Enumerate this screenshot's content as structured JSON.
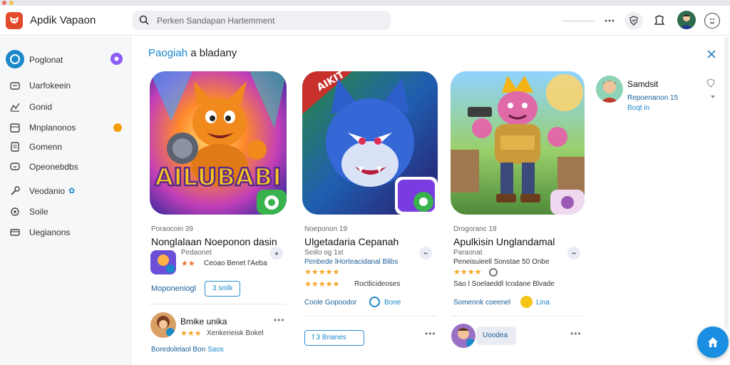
{
  "app": {
    "title": "Apdik Vapaon"
  },
  "search": {
    "placeholder": "Perken Sandapan Hartemment"
  },
  "sidebar": {
    "items": [
      {
        "label": "Poglonat",
        "icon": "compass-icon"
      },
      {
        "label": "Uarfokeein",
        "icon": "layers-icon"
      },
      {
        "label": "Gonid",
        "icon": "chart-icon"
      },
      {
        "label": "Mnplanonos",
        "icon": "calendar-icon"
      },
      {
        "label": "Gomenn",
        "icon": "document-icon"
      },
      {
        "label": "Opeonebdbs",
        "icon": "chat-icon"
      },
      {
        "label": "Veodanio",
        "icon": "wrench-icon"
      },
      {
        "label": "Soile",
        "icon": "gear-icon"
      },
      {
        "label": "Uegianons",
        "icon": "card-icon"
      }
    ]
  },
  "main": {
    "breadcrumb": {
      "part1": "Paogiah",
      "part2": "a bladany"
    }
  },
  "cards": [
    {
      "art_text": "AILUBABI",
      "category": "Poraocoin 39",
      "title": "Nonglalaan Noeponon dasin",
      "publisher": "Pedaonet",
      "rating_text": "Ceoao Benet l'Aeba",
      "stars": "★★",
      "footer_text": "Moponeniogl",
      "button_label": "3 snilk",
      "sub_name": "Bmike unika",
      "sub_stars": "★★★",
      "sub_text": "Xenkerieisk Bokel",
      "sub_footer1": "Boredolelaol",
      "sub_footer2": "Bon",
      "sub_footer3": "Saos"
    },
    {
      "art_text": "AIKIT",
      "category": "Noeponon 19",
      "title": "Ulgetadaria Cepanah",
      "publisher": "Seiilo og 1st",
      "rating_text": "Penbede lHorteacidanal Blibs",
      "stars": "★★★★★",
      "stars2": "★★★★★",
      "stars2_text": "Roctlicideoses",
      "footer_text": "Coole Gopoodor",
      "link_label": "Bone",
      "button_label": "f 3 Bnanes"
    },
    {
      "category": "Drogoranc 18",
      "title": "Apulkisin Unglandamal",
      "publisher": "Paraonat",
      "rating_text": "Peneisuieell Sonstae 50 Onbe",
      "stars": "★★★★",
      "stars2_text": "Sao l Soelaeddl Icodane Blvade",
      "footer_text": "Somennk coeenel",
      "link_label": "Lina",
      "sub_label": "Uoodea"
    }
  ],
  "right_panel": {
    "name": "Samdsit",
    "line1": "Repoenanon 15",
    "line2": "Boqt in"
  },
  "colors": {
    "accent": "#1a88c9",
    "brand": "#e24a2b",
    "badge_purple": "#8b5cf6",
    "badge_orange": "#f59e0b",
    "star": "#f5a623",
    "fab": "#1a8ee0"
  }
}
